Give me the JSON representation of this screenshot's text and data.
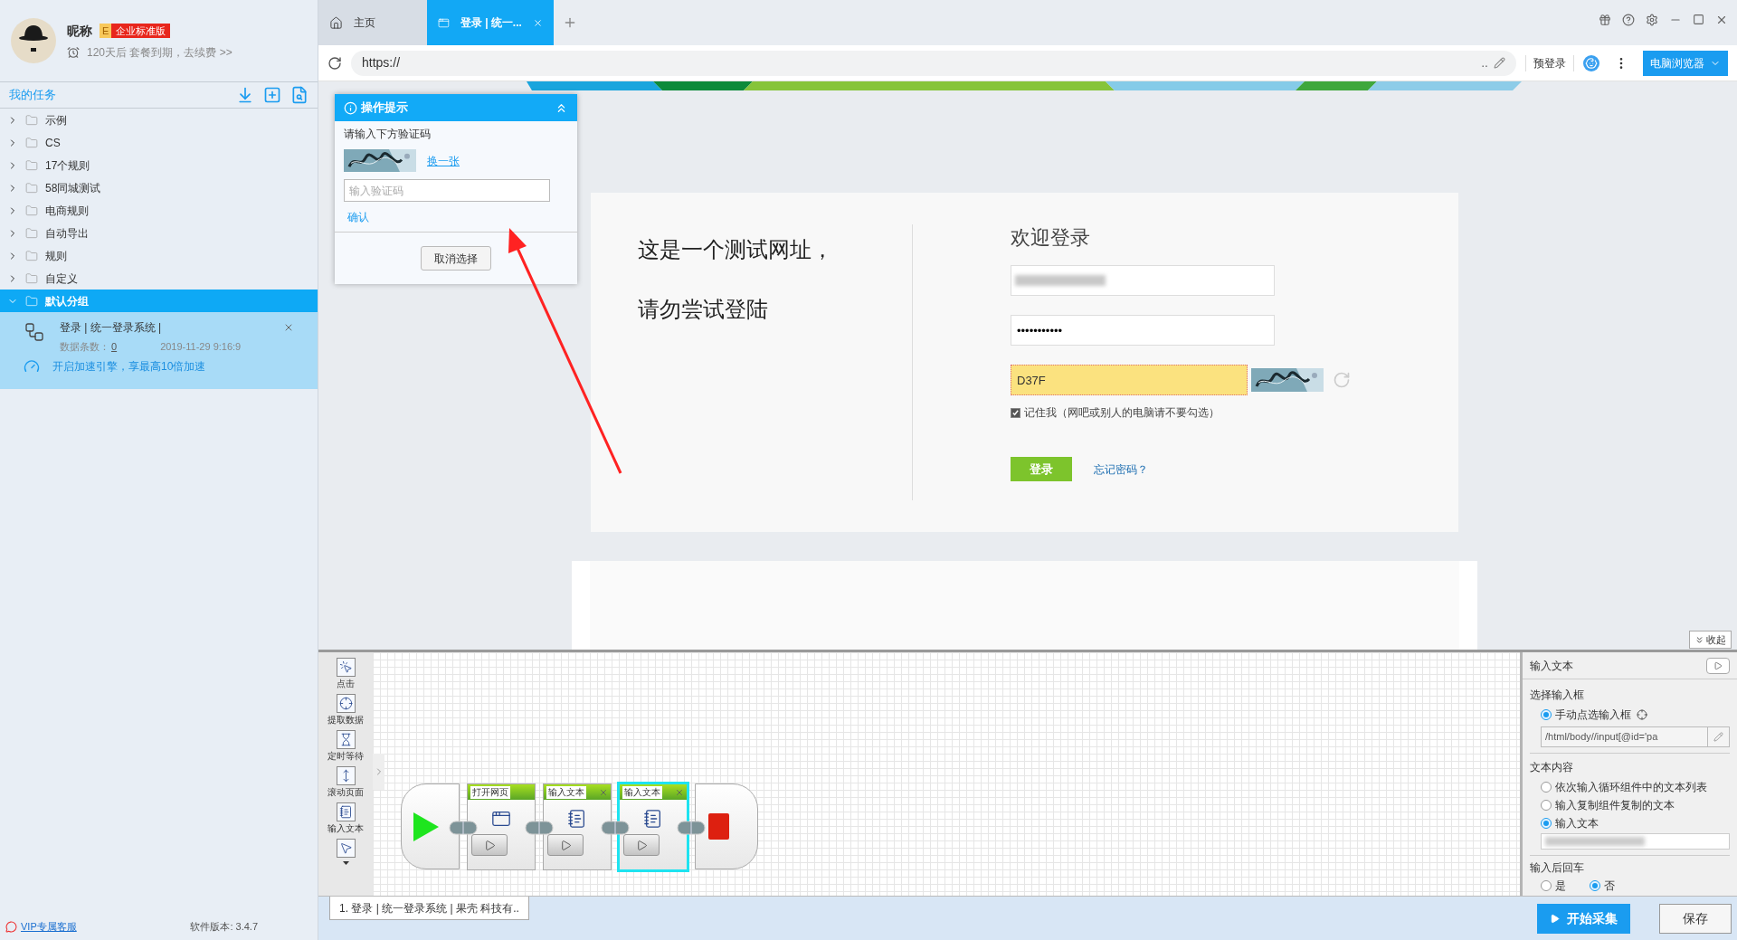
{
  "user": {
    "nickname": "昵称",
    "badge_letter": "E",
    "badge": "企业标准版",
    "expiry": "120天后 套餐到期，去续费 >>"
  },
  "sidebar": {
    "title": "我的任务",
    "groups": [
      {
        "label": "示例",
        "expanded": false,
        "selected": false
      },
      {
        "label": "CS",
        "expanded": false,
        "selected": false
      },
      {
        "label": "17个规则",
        "expanded": false,
        "selected": false
      },
      {
        "label": "58同城测试",
        "expanded": false,
        "selected": false
      },
      {
        "label": "电商规则",
        "expanded": false,
        "selected": false
      },
      {
        "label": "自动导出",
        "expanded": false,
        "selected": false
      },
      {
        "label": "规则",
        "expanded": false,
        "selected": false
      },
      {
        "label": "自定义",
        "expanded": false,
        "selected": false
      },
      {
        "label": "默认分组",
        "expanded": true,
        "selected": true,
        "tasks": [
          {
            "title": "登录 | 统一登录系统 |",
            "count_label": "数据条数：",
            "count": "0",
            "date": "2019-11-29 9:16:9",
            "promo": "开启加速引擎，享最高10倍加速"
          }
        ]
      }
    ],
    "support": "VIP专属客服",
    "version": "软件版本: 3.4.7"
  },
  "browser": {
    "tabs": [
      {
        "label": "主页",
        "kind": "home",
        "selected": false
      },
      {
        "label": "登录 | 统一...",
        "kind": "page",
        "selected": true
      }
    ],
    "url": "https://",
    "url_tail": "..",
    "prelogin": "预登录",
    "mode": "电脑浏览器"
  },
  "hint_popup": {
    "title": "操作提示",
    "prompt": "请输入下方验证码",
    "refresh": "换一张",
    "placeholder": "输入验证码",
    "confirm": "确认",
    "cancel": "取消选择"
  },
  "login_page": {
    "notice": [
      "这是一个测试网址，",
      "请勿尝试登陆"
    ],
    "heading": "欢迎登录",
    "password": "•••••••••••",
    "captcha": "D37F",
    "remember": {
      "label": "记住我（网吧或别人的电脑请不要勾选）",
      "checked": true
    },
    "submit": "登录",
    "forgot": "忘记密码？"
  },
  "workflow": {
    "collapse": "收起",
    "tools": [
      {
        "label": "点击",
        "kind": "click"
      },
      {
        "label": "提取数据",
        "kind": "extract"
      },
      {
        "label": "定时等待",
        "kind": "wait"
      },
      {
        "label": "滚动页面",
        "kind": "scroll"
      },
      {
        "label": "输入文本",
        "kind": "input"
      },
      {
        "kind": "select"
      }
    ],
    "steps": [
      {
        "title": "打开网页",
        "kind": "open",
        "closable": false,
        "selected": false
      },
      {
        "title": "输入文本",
        "kind": "input",
        "closable": true,
        "selected": false
      },
      {
        "title": "输入文本",
        "kind": "input",
        "closable": true,
        "selected": true
      }
    ],
    "task_tab": "1. 登录 | 统一登录系统 | 果壳 科技有.."
  },
  "properties": {
    "title": "输入文本",
    "select_label": "选择输入框",
    "select_options": [
      {
        "label": "手动点选输入框",
        "selected": true
      }
    ],
    "xpath": "/html/body//input[@id='pa",
    "content_label": "文本内容",
    "content_options": [
      {
        "label": "依次输入循环组件中的文本列表",
        "selected": false
      },
      {
        "label": "输入复制组件复制的文本",
        "selected": false
      },
      {
        "label": "输入文本",
        "selected": true
      }
    ],
    "enter_label": "输入后回车",
    "enter_options": [
      {
        "label": "是",
        "selected": false
      },
      {
        "label": "否",
        "selected": true
      }
    ]
  },
  "actions": {
    "start": "开始采集",
    "save": "保存"
  }
}
